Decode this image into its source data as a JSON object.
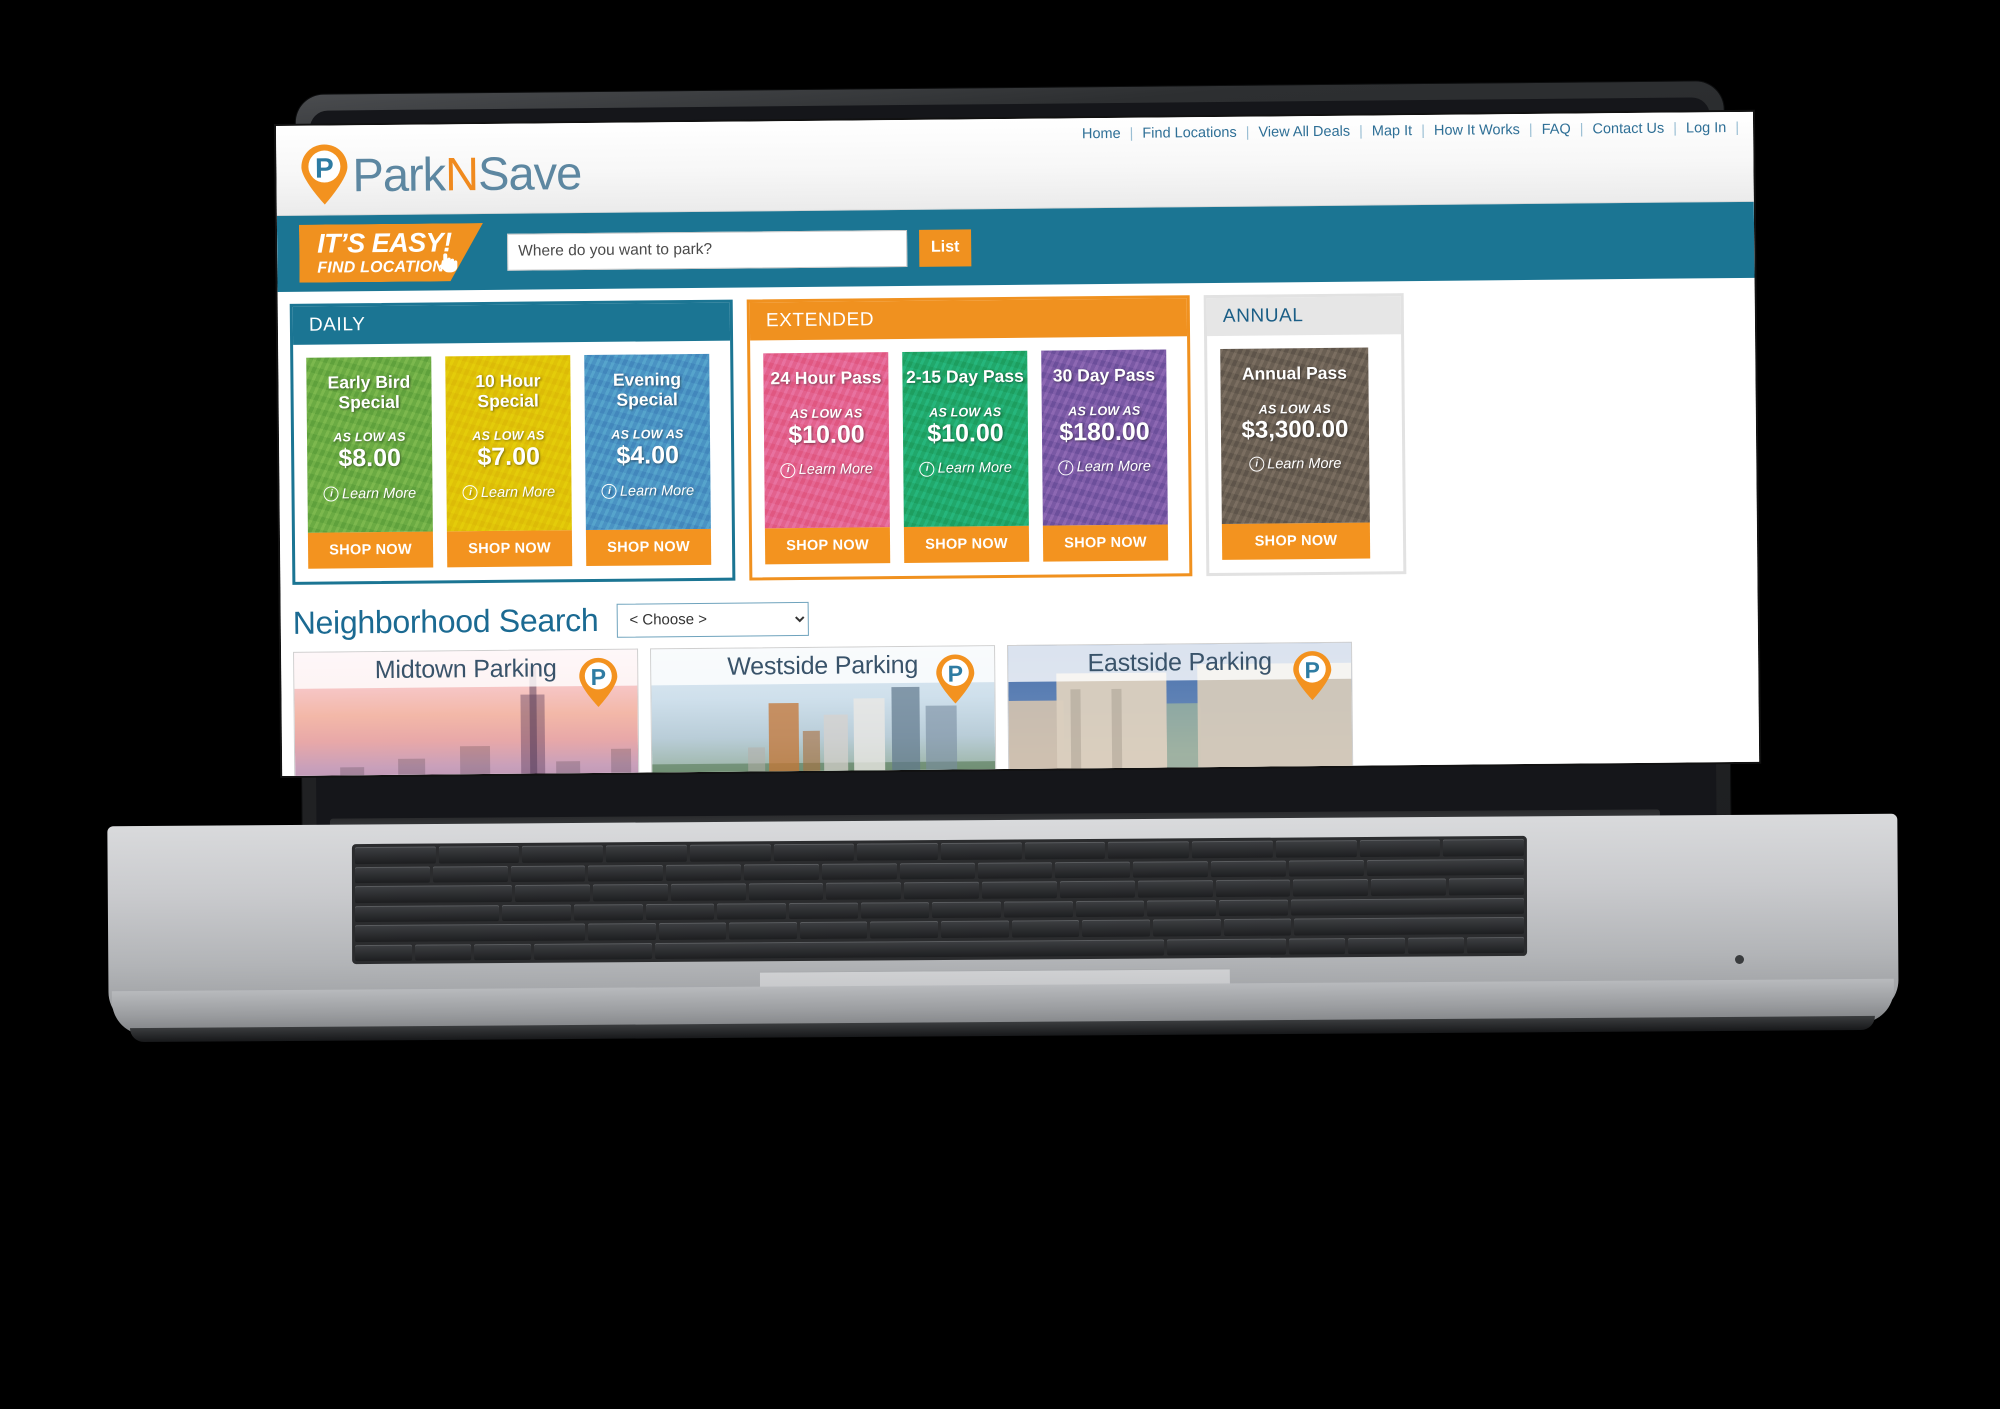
{
  "site": {
    "logo": {
      "part1": "Park",
      "part2": "N",
      "part3": "Save",
      "pin_letter": "P"
    },
    "nav": [
      {
        "label": "Home"
      },
      {
        "label": "Find Locations"
      },
      {
        "label": "View All Deals"
      },
      {
        "label": "Map It"
      },
      {
        "label": "How It Works"
      },
      {
        "label": "FAQ"
      },
      {
        "label": "Contact Us"
      },
      {
        "label": "Log In"
      }
    ],
    "nav_separator": "|"
  },
  "search": {
    "tagline_line1": "IT’S EASY!",
    "tagline_line2": "FIND LOCATIONS",
    "placeholder": "Where do you want to park?",
    "value": "",
    "button_label": "List"
  },
  "panels": [
    {
      "id": "daily",
      "title": "DAILY",
      "accent": "#1b7593",
      "deals": [
        {
          "name": "Early Bird Special",
          "as_low_as": "AS LOW AS",
          "price": "$8.00",
          "learn_more": "Learn More",
          "shop_now": "SHOP NOW",
          "color": "#6cac44"
        },
        {
          "name": "10 Hour Special",
          "as_low_as": "AS LOW AS",
          "price": "$7.00",
          "learn_more": "Learn More",
          "shop_now": "SHOP NOW",
          "color": "#e0c308"
        },
        {
          "name": "Evening Special",
          "as_low_as": "AS LOW AS",
          "price": "$4.00",
          "learn_more": "Learn More",
          "shop_now": "SHOP NOW",
          "color": "#4b94c4"
        }
      ]
    },
    {
      "id": "extended",
      "title": "EXTENDED",
      "accent": "#f0911f",
      "deals": [
        {
          "name": "24 Hour Pass",
          "as_low_as": "AS LOW AS",
          "price": "$10.00",
          "learn_more": "Learn More",
          "shop_now": "SHOP NOW",
          "color": "#e4638f"
        },
        {
          "name": "2-15 Day Pass",
          "as_low_as": "AS LOW AS",
          "price": "$10.00",
          "learn_more": "Learn More",
          "shop_now": "SHOP NOW",
          "color": "#21a96c"
        },
        {
          "name": "30 Day Pass",
          "as_low_as": "AS LOW AS",
          "price": "$180.00",
          "learn_more": "Learn More",
          "shop_now": "SHOP NOW",
          "color": "#7b5aa6"
        }
      ]
    },
    {
      "id": "annual",
      "title": "ANNUAL",
      "accent": "#e6e6e6",
      "deals": [
        {
          "name": "Annual Pass",
          "as_low_as": "AS LOW AS",
          "price": "$3,300.00",
          "learn_more": "Learn More",
          "shop_now": "SHOP NOW",
          "color": "#6b6054"
        }
      ]
    }
  ],
  "neighborhood": {
    "title": "Neighborhood Search",
    "select_value": "< Choose >",
    "options": [
      "< Choose >"
    ],
    "cards": [
      {
        "label": "Midtown Parking",
        "pin_letter": "P",
        "art": "art-midtown"
      },
      {
        "label": "Westside Parking",
        "pin_letter": "P",
        "art": "art-westside"
      },
      {
        "label": "Eastside Parking",
        "pin_letter": "P",
        "art": "art-eastside"
      }
    ]
  },
  "colors": {
    "teal": "#1b7593",
    "orange": "#f0911f",
    "link_blue": "#2e6f96",
    "heading_blue": "#1b6a92"
  }
}
